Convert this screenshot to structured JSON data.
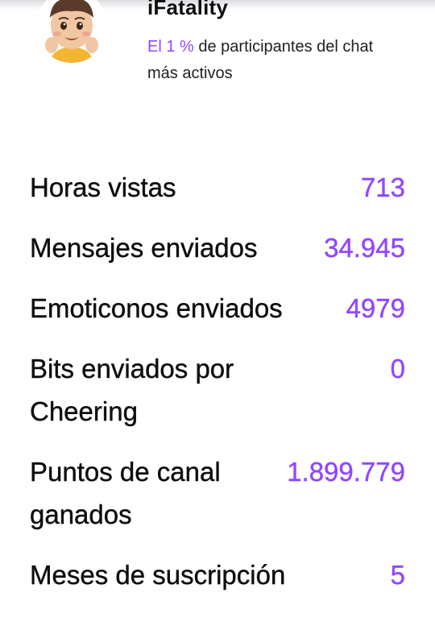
{
  "profile": {
    "username": "iFatality",
    "rank_highlight": "El 1 %",
    "rank_rest": " de participantes del chat más activos",
    "avatar_icon": "emoji-boy-avatar-icon"
  },
  "colors": {
    "accent": "#9147ff",
    "text": "#0e0e10"
  },
  "stats": [
    {
      "label": "Horas vistas",
      "value": "713"
    },
    {
      "label": "Mensajes enviados",
      "value": "34.945"
    },
    {
      "label": "Emoticonos enviados",
      "value": "4979"
    },
    {
      "label": "Bits enviados por Cheering",
      "value": "0"
    },
    {
      "label": "Puntos de canal ganados",
      "value": "1.899.779"
    },
    {
      "label": "Meses de suscripción",
      "value": "5"
    }
  ]
}
